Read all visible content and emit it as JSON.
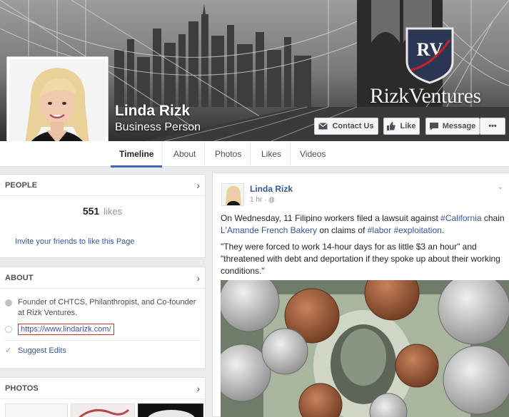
{
  "page": {
    "name": "Linda Rizk",
    "category": "Business Person"
  },
  "cover": {
    "logo_monogram": "RV",
    "brand_wordmark": "RizkVentures"
  },
  "actions": {
    "contact": "Contact Us",
    "like": "Like",
    "message": "Message",
    "more": "•••"
  },
  "nav": {
    "tabs": [
      {
        "label": "Timeline",
        "active": true
      },
      {
        "label": "About"
      },
      {
        "label": "Photos"
      },
      {
        "label": "Likes"
      },
      {
        "label": "Videos"
      }
    ]
  },
  "people": {
    "header": "PEOPLE",
    "count": "551",
    "unit": "likes",
    "invite": "Invite your friends to like this Page"
  },
  "about": {
    "header": "ABOUT",
    "description": "Founder of CHTCS, Philanthropist, and Co-founder at Rizk Ventures.",
    "website": "https://www.lindarizk.com/",
    "suggest": "Suggest Edits"
  },
  "photos": {
    "header": "PHOTOS"
  },
  "post": {
    "author": "Linda Rizk",
    "time": "1 hr · ",
    "text1_a": "On Wednesday, 11 Filipino workers filed a lawsuit against ",
    "tag_california": "#California",
    "text1_b": " chain ",
    "link_bakery": "L'Amande French Bakery",
    "text1_c": " on claims of ",
    "tag_labor": "#labor",
    "text1_d": " ",
    "tag_exploitation": "#exploitation",
    "text1_e": ".",
    "text2": "\"They were forced to work 14-hour days for as little $3 an hour\" and \"threatened with debt and deportation if they spoke up about their working conditions.\""
  },
  "colors": {
    "link": "#365899",
    "nav_active": "#4267b2",
    "highlight_box": "#d0302b",
    "logo_navy": "#2b3752"
  }
}
